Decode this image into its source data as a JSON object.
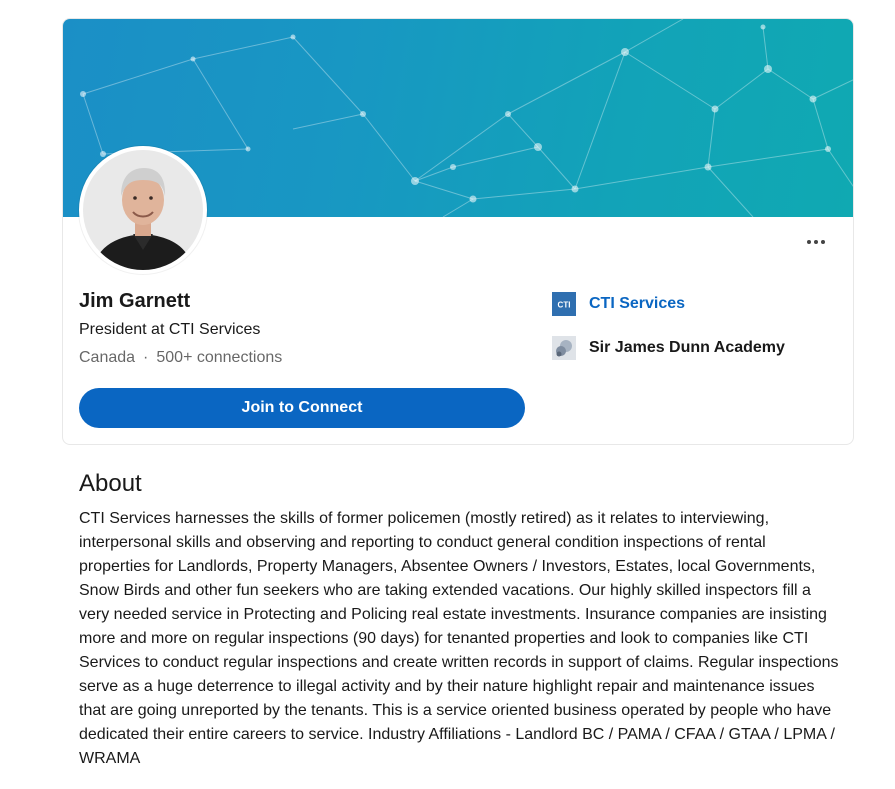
{
  "profile": {
    "name": "Jim Garnett",
    "headline": "President at CTI Services",
    "location": "Canada",
    "separator": "·",
    "connections": "500+ connections",
    "connect_label": "Join to Connect",
    "more_label": "More actions"
  },
  "experience": {
    "current_company": "CTI Services",
    "current_company_logo_text": "CTI",
    "school": "Sir James Dunn Academy"
  },
  "about": {
    "title": "About",
    "text": "CTI Services harnesses the skills of former policemen (mostly retired) as it relates to interviewing, interpersonal skills and observing and reporting to conduct general condition inspections of rental properties for Landlords, Property Managers, Absentee Owners / Investors, Estates, local Governments, Snow Birds and other fun seekers who are taking extended vacations. Our highly skilled inspectors fill a very needed service in Protecting and Policing real estate investments. Insurance companies are insisting more and more on regular inspections (90 days) for tenanted properties and look to companies like CTI Services to conduct regular inspections and create written records in support of claims. Regular inspections serve as a huge deterrence to illegal activity and by their nature highlight repair and maintenance issues that are going unreported by the tenants. This is a service oriented business operated by people who have dedicated their entire careers to service. Industry Affiliations - Landlord BC / PAMA / CFAA / GTAA / LPMA / WRAMA"
  },
  "colors": {
    "brand_blue": "#0a66c2",
    "banner_start": "#1b8fc6",
    "banner_end": "#10a9b2"
  },
  "icons": {
    "more": "ellipsis-icon",
    "company_logo": "cti-logo-icon",
    "school_logo": "school-logo-icon"
  }
}
